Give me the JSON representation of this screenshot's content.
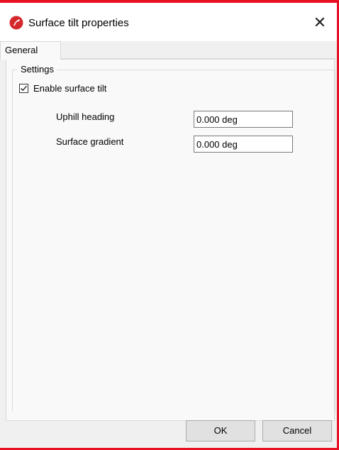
{
  "window": {
    "title": "Surface tilt properties",
    "close_glyph": "✕",
    "icon": "app-logo-icon"
  },
  "tabs": [
    {
      "label": "General",
      "selected": true
    }
  ],
  "settings": {
    "group_label": "Settings",
    "enable_tilt": {
      "label": "Enable surface tilt",
      "checked": true
    },
    "fields": [
      {
        "label": "Uphill heading",
        "value": "0.000 deg"
      },
      {
        "label": "Surface gradient",
        "value": "0.000 deg"
      }
    ]
  },
  "buttons": {
    "ok": "OK",
    "cancel": "Cancel"
  },
  "colors": {
    "accent_red": "#e81123",
    "client_bg": "#f0f0f0",
    "panel_bg": "#f9f9f9"
  }
}
